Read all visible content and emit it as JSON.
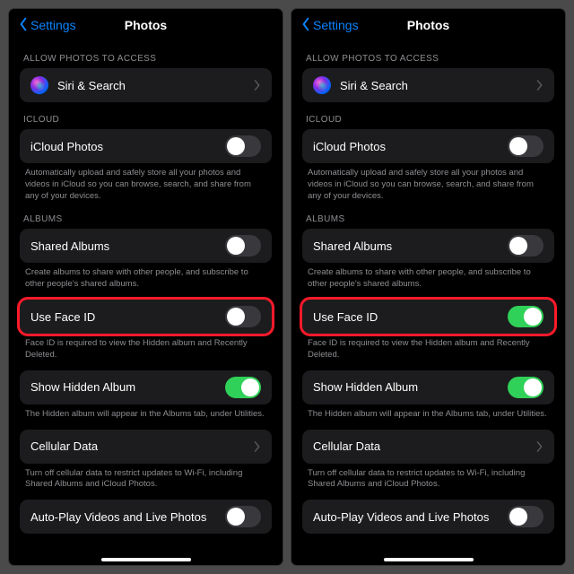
{
  "nav": {
    "back": "Settings",
    "title": "Photos"
  },
  "headers": {
    "access": "ALLOW PHOTOS TO ACCESS",
    "icloud": "ICLOUD",
    "albums": "ALBUMS"
  },
  "rows": {
    "siri": "Siri & Search",
    "icloud_photos": "iCloud Photos",
    "shared_albums": "Shared Albums",
    "use_face_id": "Use Face ID",
    "show_hidden": "Show Hidden Album",
    "cellular": "Cellular Data",
    "autoplay": "Auto-Play Videos and Live Photos"
  },
  "footers": {
    "icloud": "Automatically upload and safely store all your photos and videos in iCloud so you can browse, search, and share from any of your devices.",
    "shared": "Create albums to share with other people, and subscribe to other people's shared albums.",
    "faceid": "Face ID is required to view the Hidden album and Recently Deleted.",
    "hidden": "The Hidden album will appear in the Albums tab, under Utilities.",
    "cellular": "Turn off cellular data to restrict updates to Wi-Fi, including Shared Albums and iCloud Photos."
  },
  "panes": [
    {
      "face_id_on": false
    },
    {
      "face_id_on": true
    }
  ]
}
